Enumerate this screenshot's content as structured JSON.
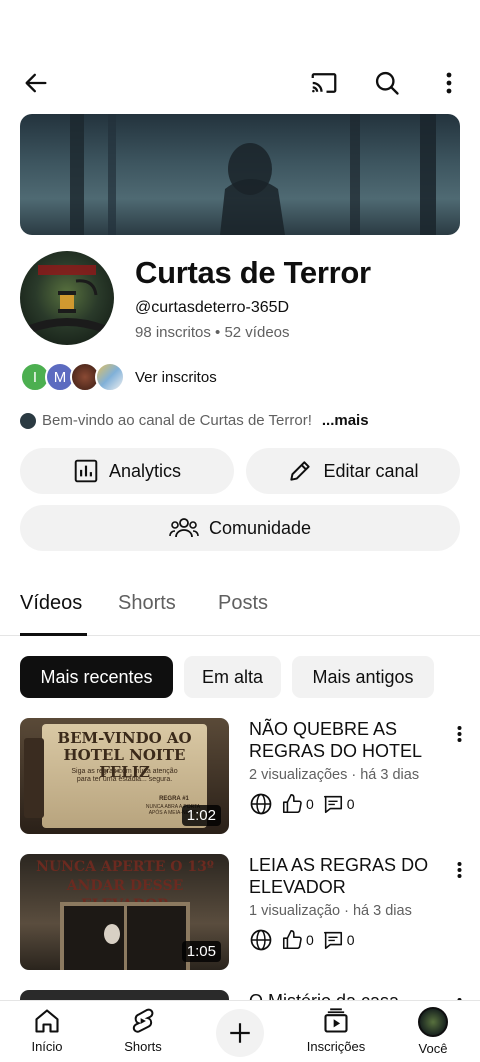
{
  "channel": {
    "name": "Curtas de Terror",
    "handle": "@curtasdeterro-365D",
    "stats": "98 inscritos • 52 vídeos",
    "subscribers_link": "Ver inscritos",
    "description": "Bem-vindo ao canal de Curtas de Terror!",
    "more": "...mais",
    "subscriber_avatars": [
      {
        "letter": "I",
        "color": "#4caf50"
      },
      {
        "letter": "M",
        "color": "#5c6bc0"
      },
      {
        "letter": "",
        "color": "#6d3b2a"
      },
      {
        "letter": "",
        "color": "#8ab4d8"
      }
    ]
  },
  "actions": {
    "analytics": "Analytics",
    "edit_channel": "Editar canal",
    "community": "Comunidade"
  },
  "tabs": [
    "Vídeos",
    "Shorts",
    "Posts"
  ],
  "filters": [
    "Mais recentes",
    "Em alta",
    "Mais antigos"
  ],
  "videos": [
    {
      "title": "NÃO QUEBRE AS REGRAS DO HOTEL",
      "meta": "2 visualizações · há 3 dias",
      "duration": "1:02",
      "likes": "0",
      "comments": "0",
      "thumb_text": "BEM-VINDO AO HOTEL NOITE FELIZ",
      "thumb_sub": "Siga as regras com muita atenção para ter uma estadia... segura.",
      "thumb_rule": "REGRA #1",
      "thumb_rule_text": "NUNCA ABRA A PORTA APÓS A MEIA-NOITE"
    },
    {
      "title": "LEIA AS REGRAS DO ELEVADOR",
      "meta": "1 visualização · há 3 dias",
      "duration": "1:05",
      "likes": "0",
      "comments": "0",
      "thumb_text": "NUNCA APERTE O 13º ANDAR DESSE ELEVADOR"
    },
    {
      "title": "O Mistério da casa"
    }
  ],
  "nav": {
    "home": "Início",
    "shorts": "Shorts",
    "subscriptions": "Inscrições",
    "you": "Você"
  }
}
